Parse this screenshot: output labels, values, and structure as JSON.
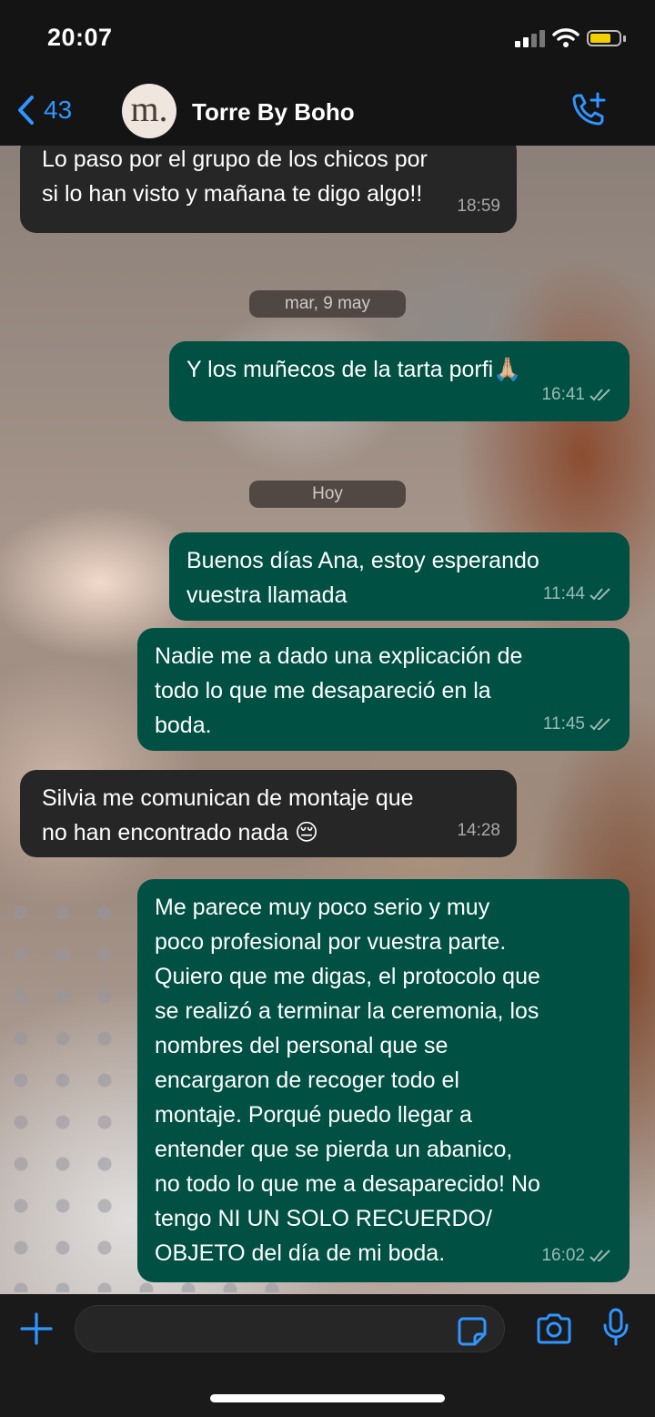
{
  "status": {
    "time": "20:07"
  },
  "header": {
    "back_count": "43",
    "avatar_letter": "m.",
    "contact_name": "Torre By Boho"
  },
  "messages": [
    {
      "type": "in",
      "text": "Lo paso por el grupo de los chicos por\nsi lo han visto y mañana te digo algo!!",
      "time": "18:59"
    },
    {
      "type": "date",
      "text": "mar, 9 may"
    },
    {
      "type": "out",
      "text": "Y los muñecos de la tarta porfi🙏🏼",
      "time": "16:41",
      "status": "read"
    },
    {
      "type": "date",
      "text": "Hoy"
    },
    {
      "type": "out",
      "text": "Buenos días Ana, estoy esperando\nvuestra llamada",
      "time": "11:44",
      "status": "read"
    },
    {
      "type": "out",
      "text": "Nadie me a dado una explicación de\ntodo lo que me desapareció en la\nboda.",
      "time": "11:45",
      "status": "read"
    },
    {
      "type": "in",
      "text": "Silvia me comunican de montaje que\nno han encontrado nada 😔",
      "time": "14:28"
    },
    {
      "type": "out",
      "text": "Me parece muy poco serio y muy\npoco profesional por vuestra parte.\nQuiero que me digas, el protocolo que\nse realizó a terminar la ceremonia, los\nnombres del personal que se\nencargaron de recoger todo el\nmontaje. Porqué puedo llegar a\nentender que se pierda un abanico,\nno todo lo que me a desaparecido! No\ntengo NI UN SOLO RECUERDO/\nOBJETO del día de mi boda.",
      "time": "16:02",
      "status": "read"
    }
  ],
  "composer": {
    "placeholder": ""
  },
  "icons": [
    "back-chevron-icon",
    "call-add-icon",
    "plus-icon",
    "sticker-icon",
    "camera-icon",
    "microphone-icon"
  ],
  "colors": {
    "accent": "#2f95ff",
    "outgoing_bubble": "#005043",
    "incoming_bubble": "#262626"
  }
}
